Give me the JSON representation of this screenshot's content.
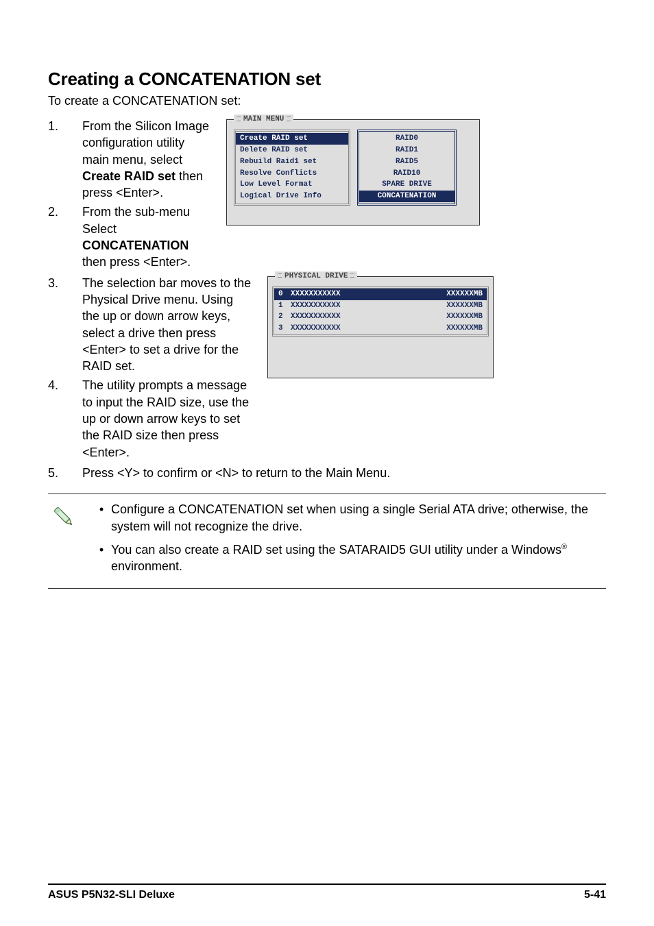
{
  "section_title": "Creating a CONCATENATION set",
  "intro": "To create a CONCATENATION set:",
  "steps": {
    "s1": {
      "num": "1.",
      "t1": "From the Silicon Image configuration utility main menu, select ",
      "bold": "Create RAID set",
      "t2": " then press <Enter>."
    },
    "s2": {
      "num": "2.",
      "t1": "From the sub-menu Select ",
      "bold": "CONCATENATION",
      "t2": " then press <Enter>."
    },
    "s3": {
      "num": "3.",
      "text": "The selection bar moves to the Physical Drive menu. Using the up or down arrow keys, select a drive then press <Enter> to set a drive for the RAID set."
    },
    "s4": {
      "num": "4.",
      "text": "The utility prompts a message to input the RAID size, use the up or down arrow keys to set the RAID size then press <Enter>."
    },
    "s5": {
      "num": "5.",
      "text": "Press <Y> to confirm or <N> to return to the Main Menu."
    }
  },
  "main_menu": {
    "title": "MAIN MENU",
    "left": [
      {
        "label": "Create RAID set",
        "selected": true
      },
      {
        "label": "Delete RAID set",
        "selected": false
      },
      {
        "label": "Rebuild Raid1 set",
        "selected": false
      },
      {
        "label": "Resolve Conflicts",
        "selected": false
      },
      {
        "label": "Low Level Format",
        "selected": false
      },
      {
        "label": "Logical Drive Info",
        "selected": false
      }
    ],
    "right": [
      {
        "label": "RAID0",
        "selected": false
      },
      {
        "label": "RAID1",
        "selected": false
      },
      {
        "label": "RAID5",
        "selected": false
      },
      {
        "label": "RAID10",
        "selected": false
      },
      {
        "label": "SPARE DRIVE",
        "selected": false
      },
      {
        "label": "CONCATENATION",
        "selected": true
      }
    ]
  },
  "physical_drive": {
    "title": "PHYSICAL DRIVE",
    "rows": [
      {
        "idx": "0",
        "name": "XXXXXXXXXXX",
        "size": "XXXXXXMB",
        "selected": true
      },
      {
        "idx": "1",
        "name": "XXXXXXXXXXX",
        "size": "XXXXXXMB",
        "selected": false
      },
      {
        "idx": "2",
        "name": "XXXXXXXXXXX",
        "size": "XXXXXXMB",
        "selected": false
      },
      {
        "idx": "3",
        "name": "XXXXXXXXXXX",
        "size": "XXXXXXMB",
        "selected": false
      }
    ]
  },
  "notes": {
    "n1a": "Configure a CONCATENATION set when using a single Serial ATA drive; otherwise, the system will not recognize the drive.",
    "n2a": "You can also create a RAID set using the SATARAID5 GUI utility under a Windows",
    "n2b": " environment.",
    "reg": "®"
  },
  "footer": {
    "left": "ASUS P5N32-SLI Deluxe",
    "right": "5-41"
  },
  "bullet": "•"
}
